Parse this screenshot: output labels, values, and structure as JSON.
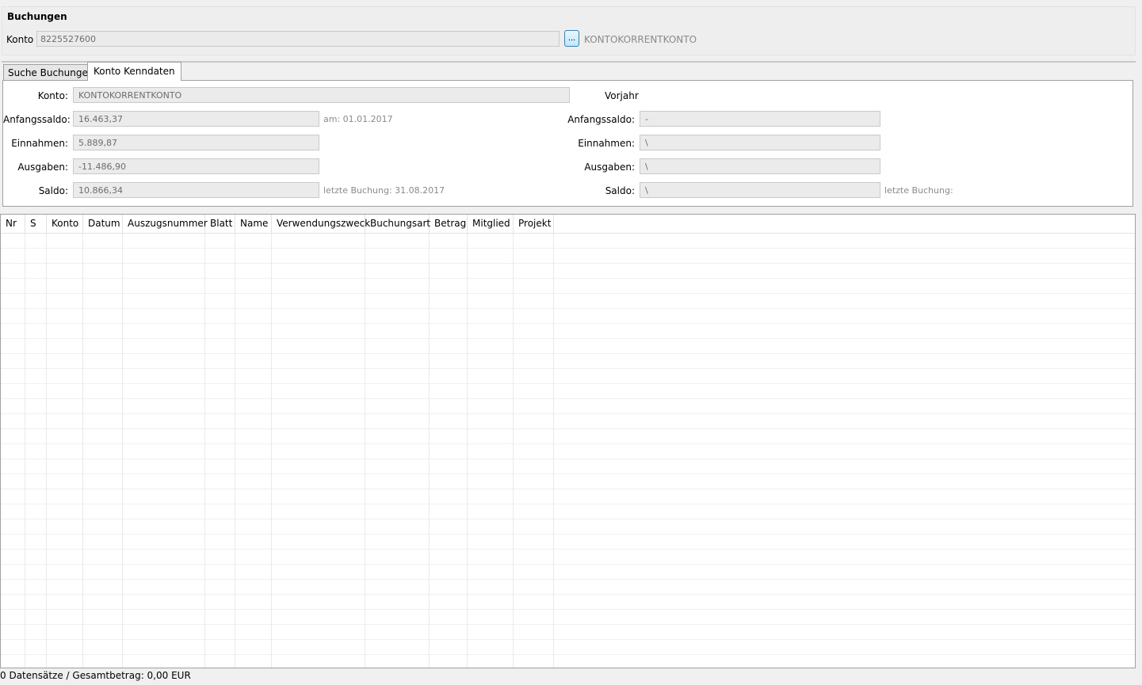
{
  "group_title": "Buchungen",
  "konto": {
    "label": "Konto",
    "value": "8225527600",
    "browse_label": "...",
    "name": "KONTOKORRENTKONTO"
  },
  "tabs": [
    {
      "label": "Suche Buchungen",
      "active": false
    },
    {
      "label": "Konto Kenndaten",
      "active": true
    }
  ],
  "kenndaten": {
    "konto_label": "Konto:",
    "konto_value": "KONTOKORRENTKONTO",
    "current": {
      "anfangssaldo_label": "Anfangssaldo:",
      "anfangssaldo": "16.463,37",
      "anfangssaldo_hint": "am: 01.01.2017",
      "einnahmen_label": "Einnahmen:",
      "einnahmen": "5.889,87",
      "ausgaben_label": "Ausgaben:",
      "ausgaben": "-11.486,90",
      "saldo_label": "Saldo:",
      "saldo": "10.866,34",
      "saldo_hint": "letzte Buchung: 31.08.2017"
    },
    "vorjahr": {
      "title": "Vorjahr",
      "anfangssaldo_label": "Anfangssaldo:",
      "anfangssaldo": "-",
      "einnahmen_label": "Einnahmen:",
      "einnahmen": "\\",
      "ausgaben_label": "Ausgaben:",
      "ausgaben": "\\",
      "saldo_label": "Saldo:",
      "saldo": "\\",
      "saldo_hint": "letzte Buchung:"
    }
  },
  "table": {
    "columns": [
      "Nr",
      "S",
      "Konto",
      "Datum",
      "Auszugsnummer",
      "Blatt",
      "Name",
      "Verwendungszweck",
      "Buchungsart",
      "Betrag",
      "Mitglied",
      "Projekt"
    ],
    "rows": []
  },
  "status": "0 Datensätze / Gesamtbetrag: 0,00 EUR"
}
